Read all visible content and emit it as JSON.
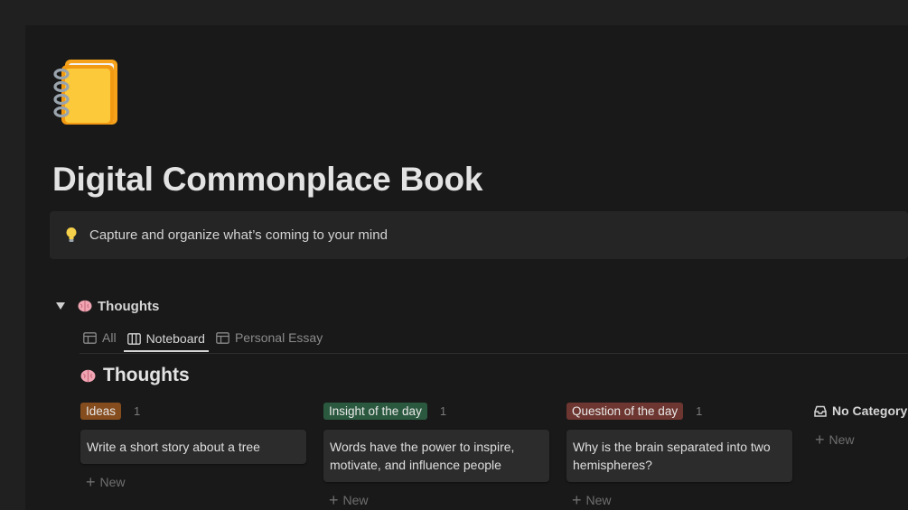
{
  "page": {
    "title": "Digital Commonplace Book",
    "callout": "Capture and organize what’s coming to your mind",
    "icon": "notebook-icon"
  },
  "database": {
    "title": "Thoughts",
    "tabs": [
      {
        "label": "All",
        "icon": "table-icon",
        "active": false
      },
      {
        "label": "Noteboard",
        "icon": "board-icon",
        "active": true
      },
      {
        "label": "Personal Essay",
        "icon": "table-icon",
        "active": false
      }
    ],
    "view_title": "Thoughts",
    "columns": [
      {
        "tag": "Ideas",
        "tag_color": "#854c1d",
        "count": "1",
        "cards": [
          "Write a short story about a tree"
        ],
        "new_label": "New"
      },
      {
        "tag": "Insight of the day",
        "tag_color": "#2b593f",
        "count": "1",
        "cards": [
          "Words have the power to inspire, motivate, and influence people"
        ],
        "new_label": "New"
      },
      {
        "tag": "Question of the day",
        "tag_color": "#6e3630",
        "count": "1",
        "cards": [
          "Why is the brain separated into two hemispheres?"
        ],
        "new_label": "New"
      },
      {
        "tag": "No Category",
        "icon": "inbox-icon",
        "cards": [],
        "new_label": "New"
      }
    ]
  },
  "colors": {
    "background": "#191919",
    "card": "#2c2c2c",
    "callout": "#252525"
  }
}
